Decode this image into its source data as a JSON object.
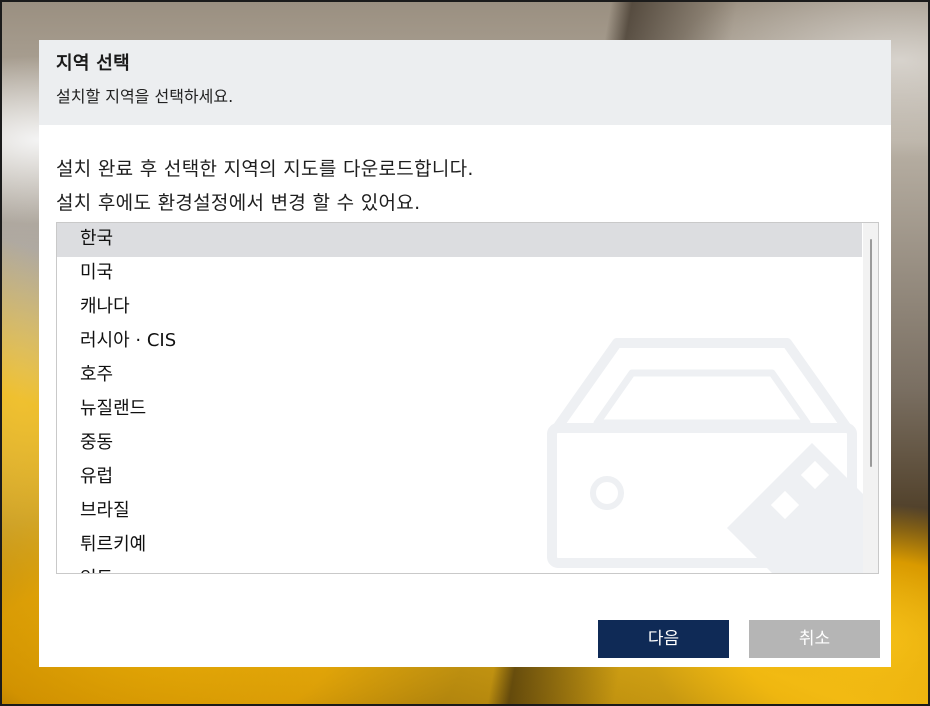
{
  "dialog": {
    "title": "지역 선택",
    "subtitle": "설치할 지역을 선택하세요.",
    "description_line1": "설치 완료 후 선택한 지역의 지도를 다운로드합니다.",
    "description_line2": "설치 후에도 환경설정에서 변경 할 수 있어요."
  },
  "regions": {
    "selected": "한국",
    "items": [
      "한국",
      "미국",
      "캐나다",
      "러시아 · CIS",
      "호주",
      "뉴질랜드",
      "중동",
      "유럽",
      "브라질",
      "튀르키예",
      "인도"
    ]
  },
  "buttons": {
    "next": "다음",
    "cancel": "취소"
  },
  "colors": {
    "primary_button": "#0f2a56",
    "disabled_button": "#b5b5b5",
    "selected_row": "#dcdde0",
    "header_bg": "#eceef0"
  }
}
